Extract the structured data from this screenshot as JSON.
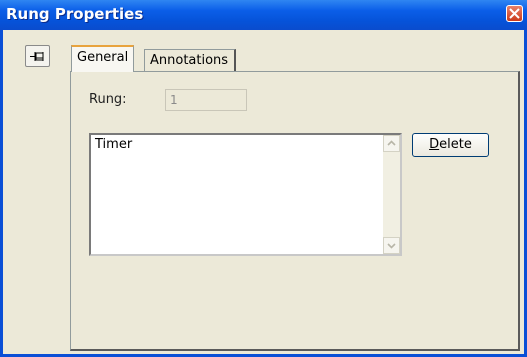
{
  "window": {
    "title": "Rung Properties",
    "close_icon": "close-icon",
    "accent": "#0a4fd6"
  },
  "toolbar": {
    "pin_icon": "pin-icon"
  },
  "tabs": [
    {
      "label": "General",
      "active": true
    },
    {
      "label": "Annotations",
      "active": false
    }
  ],
  "general": {
    "rung_label": "Rung:",
    "rung_value": "1",
    "list_items": [
      "Timer"
    ],
    "delete_label_underlined": "D",
    "delete_label_rest": "elete"
  }
}
